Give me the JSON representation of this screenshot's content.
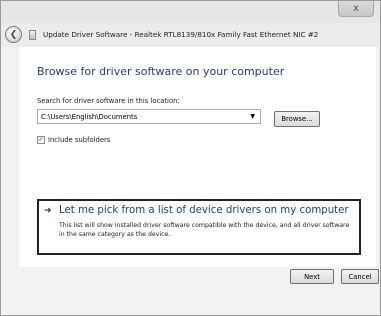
{
  "window": {
    "close_label": "x"
  },
  "header": {
    "title": "Update Driver Software - Realtek RTL8139/810x Family Fast Ethernet NIC #2",
    "back_icon": "back-arrow-icon",
    "device_icon": "network-adapter-icon"
  },
  "page": {
    "title": "Browse for driver software on your computer",
    "search_label": "Search for driver software in this location:",
    "path_value": "C:\\Users\\English\\Documents",
    "browse_label": "Browse...",
    "include_subfolders_label": "Include subfolders",
    "include_subfolders_checked": true
  },
  "pick": {
    "title": "Let me pick from a list of device drivers on my computer",
    "description": "This list will show installed driver software compatible with the device, and all driver software in the same category as the device."
  },
  "footer": {
    "next_label": "Next",
    "cancel_label": "Cancel"
  },
  "colors": {
    "accent_blue": "#1f3f7a",
    "highlight_border": "#222222"
  }
}
